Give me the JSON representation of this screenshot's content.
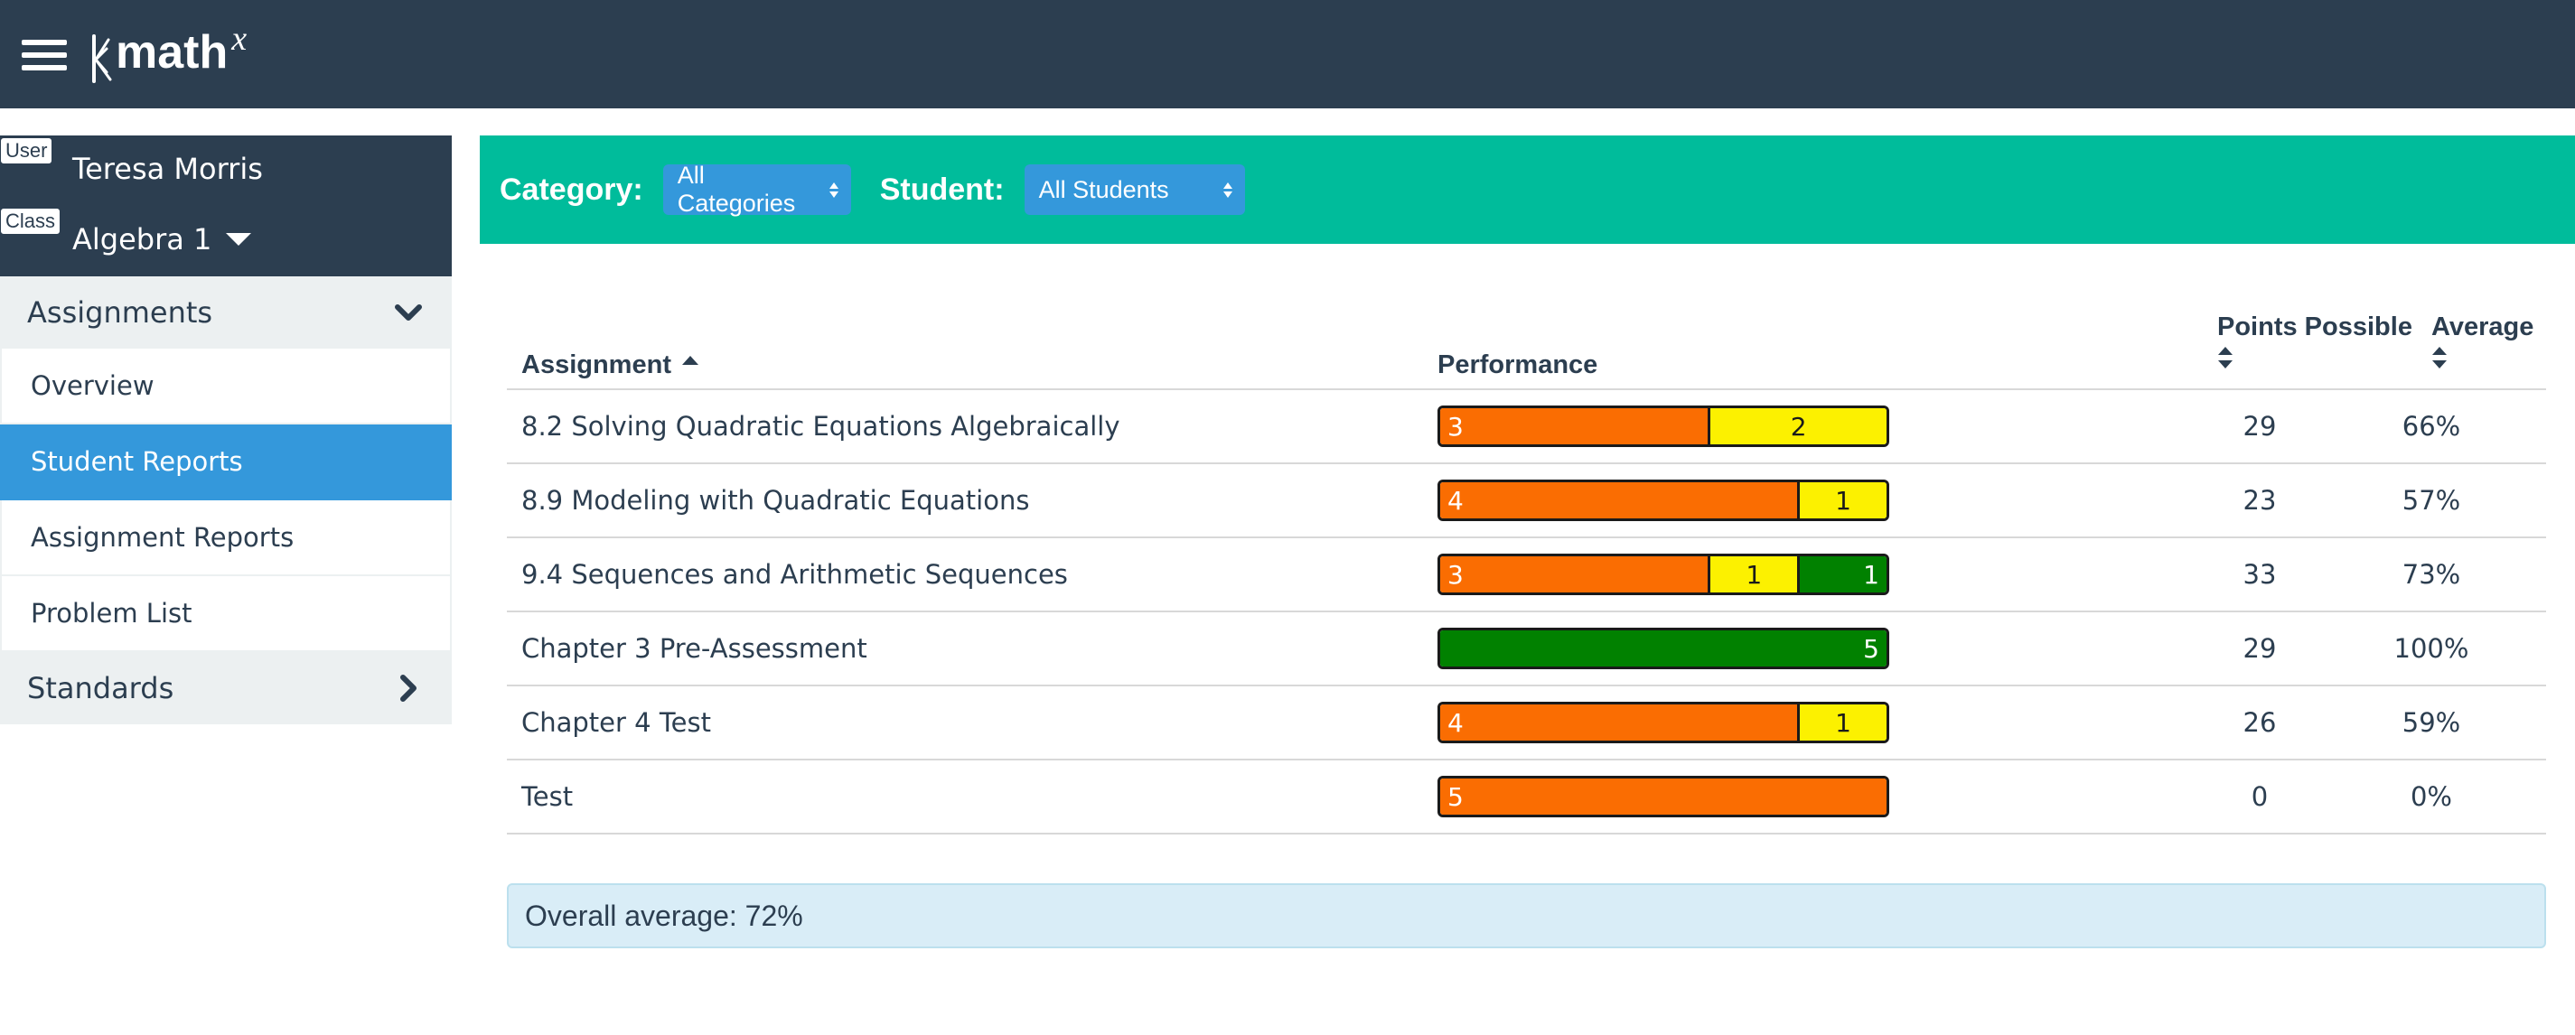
{
  "brand": {
    "name": "math",
    "superscript": "x"
  },
  "sidebar": {
    "user_tag": "User",
    "user_name": "Teresa Morris",
    "class_tag": "Class",
    "class_name": "Algebra 1",
    "sections": [
      {
        "label": "Assignments",
        "expanded": true
      },
      {
        "label": "Standards",
        "expanded": false
      }
    ],
    "items": [
      {
        "label": "Overview",
        "active": false
      },
      {
        "label": "Student Reports",
        "active": true
      },
      {
        "label": "Assignment Reports",
        "active": false
      },
      {
        "label": "Problem List",
        "active": false
      }
    ]
  },
  "filters": {
    "category_label": "Category:",
    "category_value": "All Categories",
    "student_label": "Student:",
    "student_value": "All Students"
  },
  "table": {
    "headers": {
      "assignment": "Assignment",
      "performance": "Performance",
      "points_possible": "Points Possible",
      "average": "Average"
    },
    "rows": [
      {
        "name": "8.2 Solving Quadratic Equations Algebraically",
        "performance": {
          "orange": 3,
          "yellow": 2,
          "green": 0
        },
        "points_possible": "29",
        "average": "66%"
      },
      {
        "name": "8.9 Modeling with Quadratic Equations",
        "performance": {
          "orange": 4,
          "yellow": 1,
          "green": 0
        },
        "points_possible": "23",
        "average": "57%"
      },
      {
        "name": "9.4 Sequences and Arithmetic Sequences",
        "performance": {
          "orange": 3,
          "yellow": 1,
          "green": 1
        },
        "points_possible": "33",
        "average": "73%"
      },
      {
        "name": "Chapter 3 Pre-Assessment",
        "performance": {
          "orange": 0,
          "yellow": 0,
          "green": 5
        },
        "points_possible": "29",
        "average": "100%"
      },
      {
        "name": "Chapter 4 Test",
        "performance": {
          "orange": 4,
          "yellow": 1,
          "green": 0
        },
        "points_possible": "26",
        "average": "59%"
      },
      {
        "name": "Test",
        "performance": {
          "orange": 5,
          "yellow": 0,
          "green": 0
        },
        "points_possible": "0",
        "average": "0%"
      }
    ]
  },
  "overall": "Overall average: 72%",
  "colors": {
    "topbar": "#2c3e50",
    "filter_bar": "#00bc9b",
    "active": "#3498db",
    "orange": "#fa6d02",
    "yellow": "#fcf100",
    "green": "#018100"
  }
}
